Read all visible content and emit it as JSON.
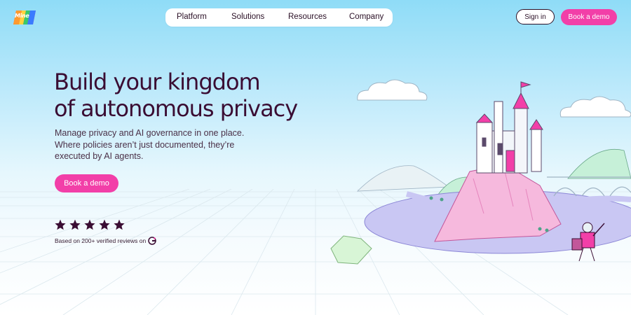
{
  "brand": {
    "logo_text": "Mine"
  },
  "nav": {
    "items": [
      {
        "label": "Platform"
      },
      {
        "label": "Solutions"
      },
      {
        "label": "Resources"
      },
      {
        "label": "Company"
      }
    ]
  },
  "header": {
    "signin_label": "Sign in",
    "book_demo_label": "Book a demo"
  },
  "hero": {
    "title_line1": "Build your kingdom",
    "title_line2": "of autonomous privacy",
    "subtitle": "Manage privacy and AI governance in one place. Where policies aren’t just documented, they’re executed by AI agents.",
    "cta_label": "Book a demo",
    "rating_stars": 5,
    "reviews_text": "Based on 200+ verified reviews on"
  },
  "colors": {
    "accent": "#f23fa8",
    "heading": "#3a0d33",
    "sky": "#8fdcf7"
  },
  "icons": [
    "logo-icon",
    "star-icon",
    "g2-icon"
  ]
}
